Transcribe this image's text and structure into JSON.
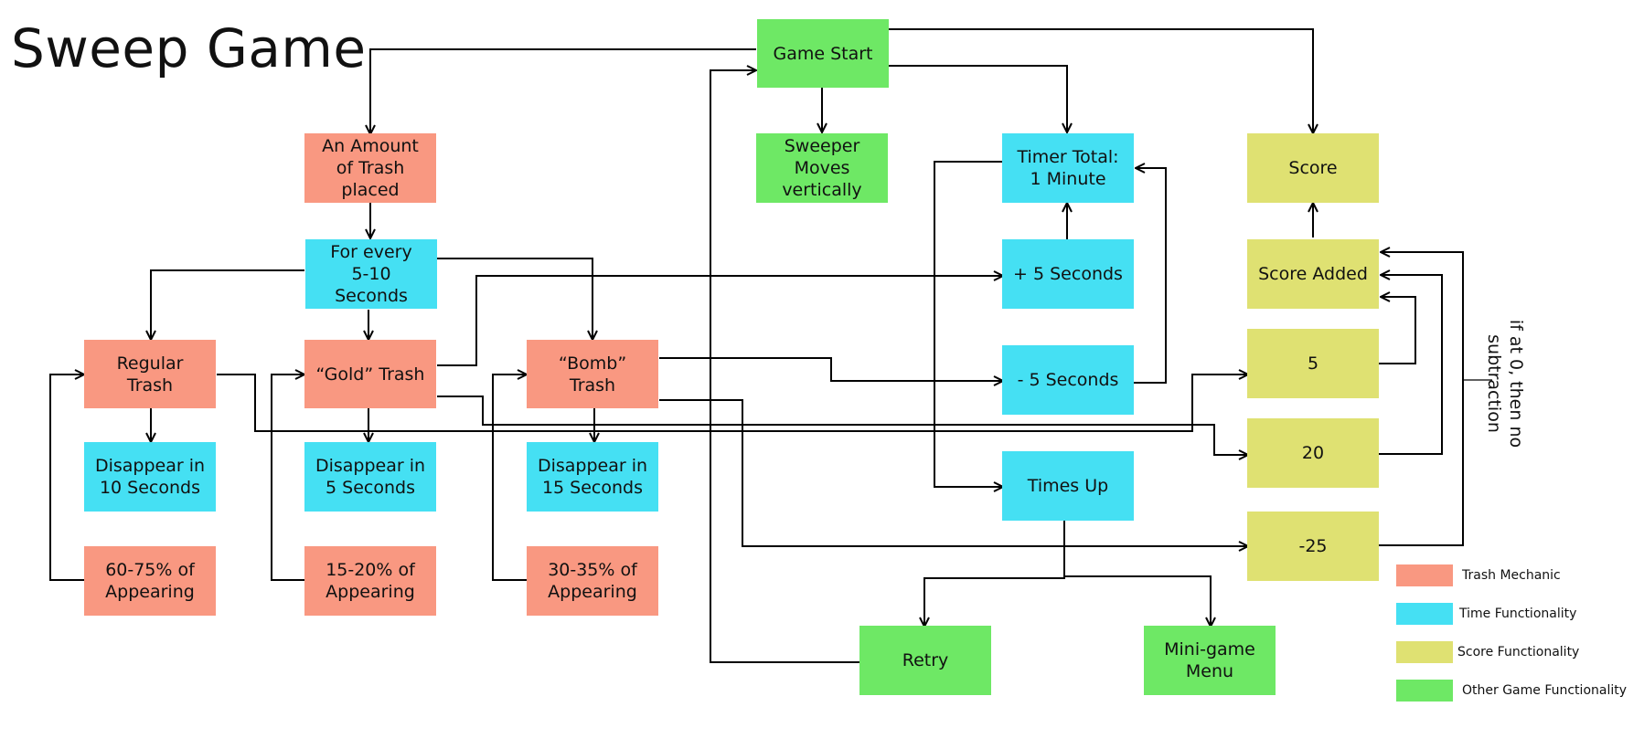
{
  "title": "Sweep Game",
  "colors": {
    "trash": "#f99881",
    "time": "#45e0f3",
    "score": "#dfe172",
    "other": "#6ee865",
    "line": "#000000"
  },
  "nodes": {
    "game_start": "Game Start",
    "sweeper_moves": "Sweeper Moves vertically",
    "amount_trash": "An Amount of Trash placed",
    "for_every": "For every 5-10 Seconds",
    "regular_trash": "Regular Trash",
    "gold_trash": "“Gold” Trash",
    "bomb_trash": "“Bomb” Trash",
    "disappear_10": "Disappear in 10 Seconds",
    "disappear_5": "Disappear in 5 Seconds",
    "disappear_15": "Disappear in 15 Seconds",
    "regular_chance": "60-75% of Appearing",
    "gold_chance": "15-20% of Appearing",
    "bomb_chance": "30-35% of Appearing",
    "timer_total": "Timer Total: 1 Minute",
    "plus_5": "+ 5 Seconds",
    "minus_5": "- 5 Seconds",
    "times_up": "Times Up",
    "retry": "Retry",
    "minigame_menu": "Mini-game Menu",
    "score": "Score",
    "score_added": "Score Added",
    "score_5": "5",
    "score_20": "20",
    "score_minus_25": "-25"
  },
  "note": "if at 0, then no subtraction",
  "legend": [
    {
      "label": "Trash Mechanic",
      "category": "trash"
    },
    {
      "label": "Time Functionality",
      "category": "time"
    },
    {
      "label": "Score Functionality",
      "category": "score"
    },
    {
      "label": "Other Game Functionality",
      "category": "other"
    }
  ],
  "edges": [
    {
      "from": "game_start",
      "to": "amount_trash"
    },
    {
      "from": "game_start",
      "to": "sweeper_moves"
    },
    {
      "from": "game_start",
      "to": "timer_total"
    },
    {
      "from": "game_start",
      "to": "score"
    },
    {
      "from": "amount_trash",
      "to": "for_every"
    },
    {
      "from": "for_every",
      "to": "regular_trash"
    },
    {
      "from": "for_every",
      "to": "gold_trash"
    },
    {
      "from": "for_every",
      "to": "bomb_trash"
    },
    {
      "from": "regular_trash",
      "to": "disappear_10"
    },
    {
      "from": "gold_trash",
      "to": "disappear_5"
    },
    {
      "from": "bomb_trash",
      "to": "disappear_15"
    },
    {
      "from": "regular_chance",
      "to": "regular_trash"
    },
    {
      "from": "gold_chance",
      "to": "gold_trash"
    },
    {
      "from": "bomb_chance",
      "to": "bomb_trash"
    },
    {
      "from": "gold_trash",
      "to": "plus_5"
    },
    {
      "from": "bomb_trash",
      "to": "minus_5"
    },
    {
      "from": "plus_5",
      "to": "timer_total"
    },
    {
      "from": "minus_5",
      "to": "timer_total"
    },
    {
      "from": "timer_total",
      "to": "times_up"
    },
    {
      "from": "times_up",
      "to": "retry"
    },
    {
      "from": "times_up",
      "to": "minigame_menu"
    },
    {
      "from": "retry",
      "to": "game_start"
    },
    {
      "from": "regular_trash",
      "to": "score_5"
    },
    {
      "from": "gold_trash",
      "to": "score_20"
    },
    {
      "from": "bomb_trash",
      "to": "score_minus_25"
    },
    {
      "from": "score_5",
      "to": "score_added"
    },
    {
      "from": "score_20",
      "to": "score_added"
    },
    {
      "from": "score_minus_25",
      "to": "score_added"
    },
    {
      "from": "score_added",
      "to": "score"
    }
  ]
}
